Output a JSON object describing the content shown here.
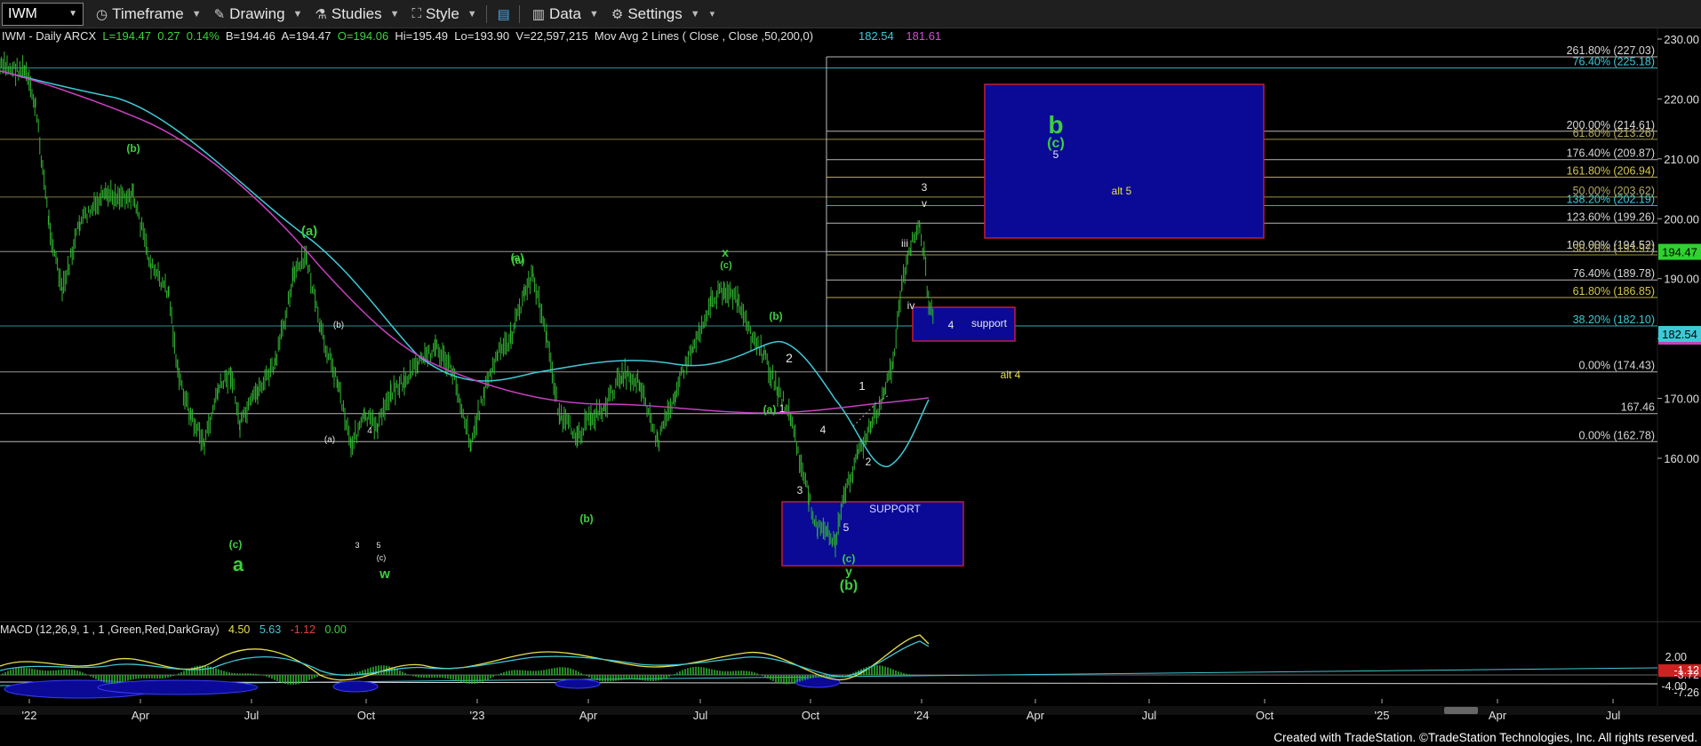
{
  "toolbar": {
    "symbol": "IWM",
    "timeframe": "Timeframe",
    "drawing": "Drawing",
    "studies": "Studies",
    "style": "Style",
    "data": "Data",
    "settings": "Settings"
  },
  "header": {
    "description": "IWM - Daily  ARCX",
    "last": "L=194.47",
    "change": "0.27",
    "change_pct": "0.14%",
    "bid": "B=194.46",
    "ask": "A=194.47",
    "open": "O=194.06",
    "high": "Hi=195.49",
    "low": "Lo=193.90",
    "volume": "V=22,597,215",
    "study": "Mov Avg 2 Lines ( Close , Close ,50,200,0)",
    "ma_fast": "182.54",
    "ma_slow": "181.61"
  },
  "price_axis": {
    "ticks": [
      "230.00",
      "220.00",
      "210.00",
      "200.00",
      "190.00",
      "180.00",
      "170.00",
      "160.00"
    ],
    "last_price_tag": "194.47",
    "ma_tag": "182.54"
  },
  "macd": {
    "label": "MACD (12,26,9, 1 , 1 ,Green,Red,DarkGray)",
    "macd_value": "4.50",
    "signal_value": "5.63",
    "hist_value": "-1.12",
    "zero_value": "0.00",
    "axis_ticks": [
      "2.00",
      "-4.00"
    ],
    "tags": [
      "-1.12",
      "-3.72",
      "-7.26"
    ]
  },
  "time_axis": [
    "'22",
    "Apr",
    "Jul",
    "Oct",
    "'23",
    "Apr",
    "Jul",
    "Oct",
    "'24",
    "Apr",
    "Jul",
    "Oct",
    "'25",
    "Apr",
    "Jul"
  ],
  "fib_levels": [
    {
      "label": "261.80% (227.03)",
      "price": 227.03,
      "color": "#d8d8d8"
    },
    {
      "label": "76.40% (225.18)",
      "price": 225.18,
      "color": "#3ec9d6"
    },
    {
      "label": "200.00% (214.61)",
      "price": 214.61,
      "color": "#d8d8d8"
    },
    {
      "label": "61.80% (213.26)",
      "price": 213.26,
      "color": "#b6ab5c"
    },
    {
      "label": "176.40% (209.87)",
      "price": 209.87,
      "color": "#d8d8d8"
    },
    {
      "label": "161.80% (206.94)",
      "price": 206.94,
      "color": "#d4c94a"
    },
    {
      "label": "50.00% (203.62)",
      "price": 203.62,
      "color": "#b6ab5c"
    },
    {
      "label": "138.20% (202.19)",
      "price": 202.19,
      "color": "#3ec9d6"
    },
    {
      "label": "123.60% (199.26)",
      "price": 199.26,
      "color": "#d8d8d8"
    },
    {
      "label": "100.00% (194.52)",
      "price": 194.52,
      "color": "#d8d8d8"
    },
    {
      "label": "38.20% (193.97)",
      "price": 193.97,
      "color": "#b6ab5c"
    },
    {
      "label": "76.40% (189.78)",
      "price": 189.78,
      "color": "#d8d8d8"
    },
    {
      "label": "61.80% (186.85)",
      "price": 186.85,
      "color": "#d4c94a"
    },
    {
      "label": "38.20% (182.10)",
      "price": 182.1,
      "color": "#3ec9d6"
    },
    {
      "label": "0.00% (174.43)",
      "price": 174.43,
      "color": "#d8d8d8"
    },
    {
      "label": "167.46",
      "price": 167.46,
      "color": "#d8d8d8"
    },
    {
      "label": "0.00% (162.78)",
      "price": 162.78,
      "color": "#d8d8d8"
    }
  ],
  "annotations": {
    "support_upper": "support",
    "support_upper_wave": "4",
    "support_lower": "SUPPORT",
    "target_box_b": "b",
    "target_box_c": "(c)",
    "target_box_5": "5",
    "alt5": "alt 5",
    "alt4": "alt 4",
    "labels": [
      {
        "t": "(b)",
        "c": "green"
      },
      {
        "t": "(a)",
        "c": "green"
      },
      {
        "t": "(a)",
        "c": "green"
      },
      {
        "t": "(c)",
        "c": "green"
      },
      {
        "t": "a",
        "c": "green"
      },
      {
        "t": "(b)",
        "c": "white"
      },
      {
        "t": "(a)",
        "c": "white"
      },
      {
        "t": "4",
        "c": "white"
      },
      {
        "t": "3",
        "c": "white"
      },
      {
        "t": "5",
        "c": "white"
      },
      {
        "t": "(c)",
        "c": "white"
      },
      {
        "t": "w",
        "c": "green"
      },
      {
        "t": "(a)",
        "c": "green"
      },
      {
        "t": "(b)",
        "c": "green"
      },
      {
        "t": "x",
        "c": "green"
      },
      {
        "t": "(c)",
        "c": "green"
      },
      {
        "t": "(b)",
        "c": "green"
      },
      {
        "t": "2",
        "c": "white"
      },
      {
        "t": "1",
        "c": "white"
      },
      {
        "t": "(a)",
        "c": "green"
      },
      {
        "t": "4",
        "c": "white"
      },
      {
        "t": "3",
        "c": "white"
      },
      {
        "t": "5",
        "c": "white"
      },
      {
        "t": "(c)",
        "c": "green"
      },
      {
        "t": "y",
        "c": "green"
      },
      {
        "t": "(b)",
        "c": "green"
      },
      {
        "t": "1",
        "c": "white"
      },
      {
        "t": "2",
        "c": "white"
      },
      {
        "t": "iii",
        "c": "white"
      },
      {
        "t": "iv",
        "c": "white"
      },
      {
        "t": "v",
        "c": "white"
      },
      {
        "t": "3",
        "c": "white"
      }
    ]
  },
  "colors": {
    "bars": "#31b531",
    "ma_fast": "#3ec9d6",
    "ma_slow": "#c640c0",
    "box_fill": "#0a0a96",
    "box_border": "#c21c3c",
    "last_tag": "#2fd12f",
    "ma_tag": "#3ec9d6"
  },
  "footer": {
    "credit": "Created with TradeStation. ©TradeStation Technologies, Inc. All rights reserved."
  }
}
